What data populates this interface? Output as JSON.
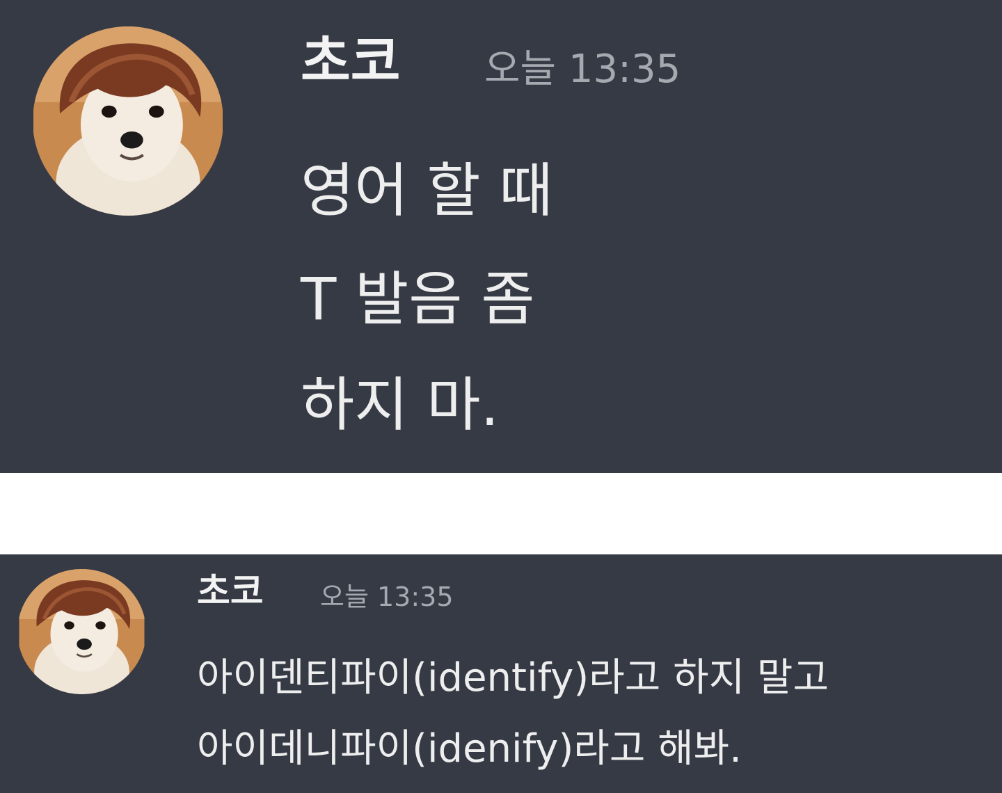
{
  "messages": [
    {
      "username": "초코",
      "timestamp": "오늘 13:35",
      "avatar_icon": "dog-with-wig-avatar",
      "lines": [
        "영어 할 때",
        "T 발음 좀",
        "하지 마."
      ]
    },
    {
      "username": "초코",
      "timestamp": "오늘 13:35",
      "avatar_icon": "dog-with-wig-avatar",
      "lines": [
        "아이덴티파이(identify)라고 하지 말고",
        "아이데니파이(idenify)라고 해봐."
      ]
    }
  ],
  "colors": {
    "panel_background": "#353a45",
    "page_gap": "#ffffff",
    "username": "#f3f3f3",
    "timestamp": "#a6a9b0",
    "message_text": "#eeeeee"
  }
}
